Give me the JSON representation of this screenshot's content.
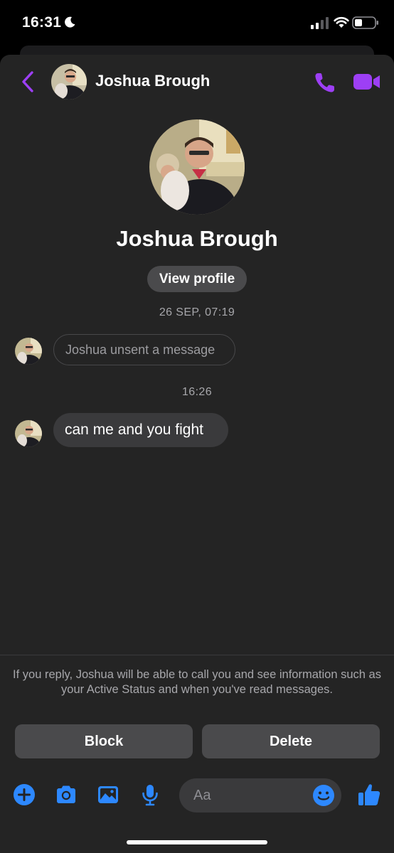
{
  "status_bar": {
    "time": "16:31"
  },
  "header": {
    "contact_name": "Joshua Brough",
    "icons": [
      "chevron-left-icon",
      "phone-icon",
      "video-camera-icon"
    ]
  },
  "profile": {
    "name": "Joshua Brough",
    "view_profile_label": "View profile"
  },
  "messages": [
    {
      "timestamp": "26 SEP, 07:19",
      "text": "Joshua unsent a message",
      "type": "unsent"
    },
    {
      "timestamp": "16:26",
      "text": "can me and you fight",
      "type": "received"
    }
  ],
  "request_panel": {
    "notice": "If you reply, Joshua will be able to call you and see information such as your Active Status and when you've read messages.",
    "block_label": "Block",
    "delete_label": "Delete"
  },
  "composer": {
    "placeholder": "Aa",
    "icons": [
      "plus-circle-icon",
      "camera-icon",
      "image-icon",
      "microphone-icon",
      "emoji-icon",
      "thumbs-up-icon"
    ]
  },
  "colors": {
    "accent_purple": "#9d3ff5",
    "accent_blue": "#2d88ff",
    "background": "#242424",
    "bubble": "#3a3a3c"
  }
}
